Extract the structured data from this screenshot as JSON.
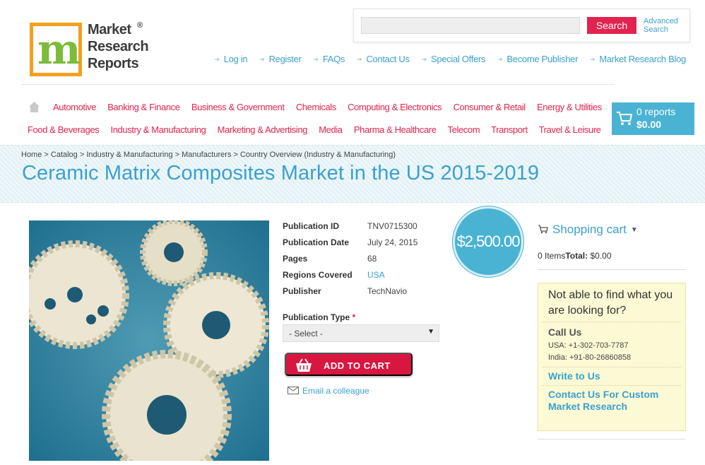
{
  "logo": {
    "line1": "Market",
    "line2": "Research",
    "line3": "Reports",
    "reg": "®",
    "letter": "m"
  },
  "search": {
    "placeholder": "",
    "button": "Search",
    "advanced": "Advanced Search"
  },
  "top_links": [
    "Log in",
    "Register",
    "FAQs",
    "Contact Us",
    "Special Offers",
    "Become Publisher",
    "Market Research Blog"
  ],
  "categories_row1": [
    "Automotive",
    "Banking & Finance",
    "Business & Government",
    "Chemicals",
    "Computing & Electronics",
    "Consumer & Retail",
    "Energy & Utilities"
  ],
  "categories_row2": [
    "Food & Beverages",
    "Industry & Manufacturing",
    "Marketing & Advertising",
    "Media",
    "Pharma & Healthcare",
    "Telecom",
    "Transport",
    "Travel & Leisure"
  ],
  "cart": {
    "reports": "0 reports",
    "total": "$0.00"
  },
  "breadcrumb": "Home > Catalog > Industry & Manufacturing > Manufacturers > Country Overview (Industry & Manufacturing)",
  "title": "Ceramic Matrix Composites Market in the US 2015-2019",
  "details": [
    {
      "label": "Publication ID",
      "value": "TNV0715300"
    },
    {
      "label": "Publication Date",
      "value": "July 24, 2015"
    },
    {
      "label": "Pages",
      "value": "68"
    },
    {
      "label": "Regions Covered",
      "value": "USA"
    },
    {
      "label": "Publisher",
      "value": "TechNavio"
    }
  ],
  "pub_type": {
    "label": "Publication Type",
    "required": "*",
    "selected": "- Select -"
  },
  "add_to_cart": "ADD TO CART",
  "email_colleague": "Email a colleague",
  "price": "$2,500.00",
  "shopping_cart": {
    "title": "Shopping cart",
    "items": "0 Items",
    "total_label": "Total:",
    "total_value": "$0.00"
  },
  "help": {
    "question": "Not able to find what you are looking for?",
    "call_title": "Call Us",
    "usa": "USA: +1-302-703-7787",
    "india": "India: +91-80-26860858",
    "write": "Write to Us",
    "custom": "Contact Us For Custom Market Research"
  },
  "colors": {
    "accent": "#3aa1cf",
    "brand_red": "#e2234f",
    "cart_blue": "#4ab3d3",
    "help_bg": "#fbfad5"
  }
}
